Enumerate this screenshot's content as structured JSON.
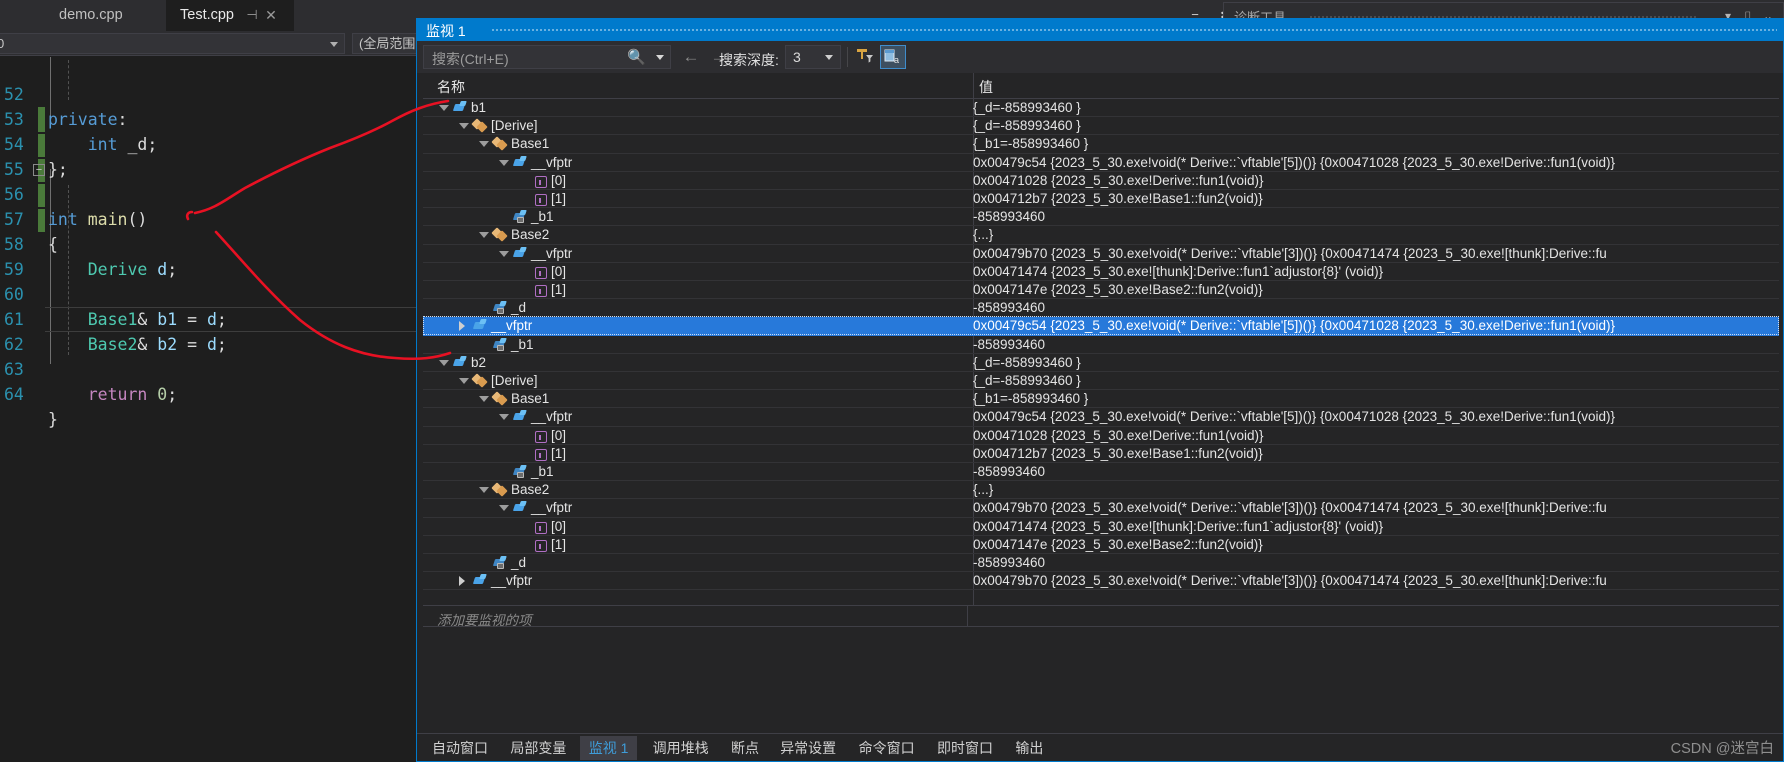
{
  "editor": {
    "tabs": [
      {
        "label": "demo.cpp",
        "active": false
      },
      {
        "label": "Test.cpp",
        "active": true
      }
    ],
    "tab_pin_icon": "pin-icon",
    "tab_close_icon": "close-icon",
    "navbar": {
      "scope_combo": "0",
      "member_combo": "(全局范围"
    },
    "lines": [
      {
        "no": "52",
        "text": "private:"
      },
      {
        "no": "53",
        "text": "    int _d;"
      },
      {
        "no": "54",
        "text": "};"
      },
      {
        "no": "55",
        "text": ""
      },
      {
        "no": "56",
        "text": "int main()"
      },
      {
        "no": "57",
        "text": "{"
      },
      {
        "no": "58",
        "text": "    Derive d;"
      },
      {
        "no": "59",
        "text": ""
      },
      {
        "no": "60",
        "text": "    Base1& b1 = d;"
      },
      {
        "no": "61",
        "text": "    Base2& b2 = d;"
      },
      {
        "no": "62",
        "text": ""
      },
      {
        "no": "63",
        "text": "    return 0;"
      },
      {
        "no": "64",
        "text": "}"
      }
    ]
  },
  "background_window": {
    "title": "诊断工具",
    "dropdown_icon": "chevron-down-icon",
    "pin_icon": "pin-icon",
    "close_icon": "chevron-down-icon"
  },
  "watch": {
    "caption": "监视 1",
    "toolbar": {
      "search_placeholder": "搜索(Ctrl+E)",
      "search_icon": "search-icon",
      "search_dropdown_icon": "chevron-down-icon",
      "prev_icon": "arrow-left-icon",
      "next_icon": "arrow-right-icon",
      "depth_label": "搜索深度:",
      "depth_value": "3",
      "depth_dropdown_icon": "chevron-down-icon",
      "pin_button_icon": "pin-filter-icon",
      "hex_button_icon": "hexadecimal-display-icon"
    },
    "columns": [
      "名称",
      "值"
    ],
    "rows": [
      {
        "indent": 0,
        "exp": "open",
        "icon": "field",
        "name": "b1",
        "value": "{_d=-858993460 }"
      },
      {
        "indent": 1,
        "exp": "open",
        "icon": "class",
        "name": "[Derive]",
        "value": "{_d=-858993460 }"
      },
      {
        "indent": 2,
        "exp": "open",
        "icon": "class",
        "name": "Base1",
        "value": "{_b1=-858993460 }"
      },
      {
        "indent": 3,
        "exp": "open",
        "icon": "field",
        "name": "__vfptr",
        "value": "0x00479c54 {2023_5_30.exe!void(* Derive::`vftable'[5])()} {0x00471028 {2023_5_30.exe!Derive::fun1(void)}"
      },
      {
        "indent": 4,
        "exp": "none",
        "icon": "elem",
        "name": "[0]",
        "value": "0x00471028 {2023_5_30.exe!Derive::fun1(void)}"
      },
      {
        "indent": 4,
        "exp": "none",
        "icon": "elem",
        "name": "[1]",
        "value": "0x004712b7 {2023_5_30.exe!Base1::fun2(void)}"
      },
      {
        "indent": 3,
        "exp": "none",
        "icon": "lock",
        "name": "_b1",
        "value": "-858993460"
      },
      {
        "indent": 2,
        "exp": "open",
        "icon": "class",
        "name": "Base2",
        "value": "{...}"
      },
      {
        "indent": 3,
        "exp": "open",
        "icon": "field",
        "name": "__vfptr",
        "value": "0x00479b70 {2023_5_30.exe!void(* Derive::`vftable'[3])()} {0x00471474 {2023_5_30.exe![thunk]:Derive::fu"
      },
      {
        "indent": 4,
        "exp": "none",
        "icon": "elem",
        "name": "[0]",
        "value": "0x00471474 {2023_5_30.exe![thunk]:Derive::fun1`adjustor{8}' (void)}"
      },
      {
        "indent": 4,
        "exp": "none",
        "icon": "elem",
        "name": "[1]",
        "value": "0x0047147e {2023_5_30.exe!Base2::fun2(void)}"
      },
      {
        "indent": 2,
        "exp": "none",
        "icon": "lock",
        "name": "_d",
        "value": "-858993460"
      },
      {
        "indent": 1,
        "exp": "closed",
        "icon": "field",
        "name": "__vfptr",
        "value": "0x00479c54 {2023_5_30.exe!void(* Derive::`vftable'[5])()} {0x00471028 {2023_5_30.exe!Derive::fun1(void)}",
        "selected": true
      },
      {
        "indent": 2,
        "exp": "none",
        "icon": "lock",
        "name": "_b1",
        "value": "-858993460"
      },
      {
        "indent": 0,
        "exp": "open",
        "icon": "field",
        "name": "b2",
        "value": "{_d=-858993460 }"
      },
      {
        "indent": 1,
        "exp": "open",
        "icon": "class",
        "name": "[Derive]",
        "value": "{_d=-858993460 }"
      },
      {
        "indent": 2,
        "exp": "open",
        "icon": "class",
        "name": "Base1",
        "value": "{_b1=-858993460 }"
      },
      {
        "indent": 3,
        "exp": "open",
        "icon": "field",
        "name": "__vfptr",
        "value": "0x00479c54 {2023_5_30.exe!void(* Derive::`vftable'[5])()} {0x00471028 {2023_5_30.exe!Derive::fun1(void)}"
      },
      {
        "indent": 4,
        "exp": "none",
        "icon": "elem",
        "name": "[0]",
        "value": "0x00471028 {2023_5_30.exe!Derive::fun1(void)}"
      },
      {
        "indent": 4,
        "exp": "none",
        "icon": "elem",
        "name": "[1]",
        "value": "0x004712b7 {2023_5_30.exe!Base1::fun2(void)}"
      },
      {
        "indent": 3,
        "exp": "none",
        "icon": "lock",
        "name": "_b1",
        "value": "-858993460"
      },
      {
        "indent": 2,
        "exp": "open",
        "icon": "class",
        "name": "Base2",
        "value": "{...}"
      },
      {
        "indent": 3,
        "exp": "open",
        "icon": "field",
        "name": "__vfptr",
        "value": "0x00479b70 {2023_5_30.exe!void(* Derive::`vftable'[3])()} {0x00471474 {2023_5_30.exe![thunk]:Derive::fu"
      },
      {
        "indent": 4,
        "exp": "none",
        "icon": "elem",
        "name": "[0]",
        "value": "0x00471474 {2023_5_30.exe![thunk]:Derive::fun1`adjustor{8}' (void)}"
      },
      {
        "indent": 4,
        "exp": "none",
        "icon": "elem",
        "name": "[1]",
        "value": "0x0047147e {2023_5_30.exe!Base2::fun2(void)}"
      },
      {
        "indent": 2,
        "exp": "none",
        "icon": "lock",
        "name": "_d",
        "value": "-858993460"
      },
      {
        "indent": 1,
        "exp": "closed",
        "icon": "field",
        "name": "__vfptr",
        "value": "0x00479b70 {2023_5_30.exe!void(* Derive::`vftable'[3])()} {0x00471474 {2023_5_30.exe![thunk]:Derive::fu"
      }
    ],
    "add_watch_placeholder": "添加要监视的项",
    "bottom_tabs": [
      {
        "label": "自动窗口",
        "active": false
      },
      {
        "label": "局部变量",
        "active": false
      },
      {
        "label": "监视 1",
        "active": true
      },
      {
        "label": "调用堆栈",
        "active": false
      },
      {
        "label": "断点",
        "active": false
      },
      {
        "label": "异常设置",
        "active": false
      },
      {
        "label": "命令窗口",
        "active": false
      },
      {
        "label": "即时窗口",
        "active": false
      },
      {
        "label": "输出",
        "active": false
      }
    ]
  },
  "watermark": "CSDN @迷宫白",
  "colors": {
    "accent": "#007acc",
    "selection": "#2779da",
    "annotation": "#e81123",
    "editor_bg": "#1e1e1e",
    "panel_bg": "#252526"
  }
}
